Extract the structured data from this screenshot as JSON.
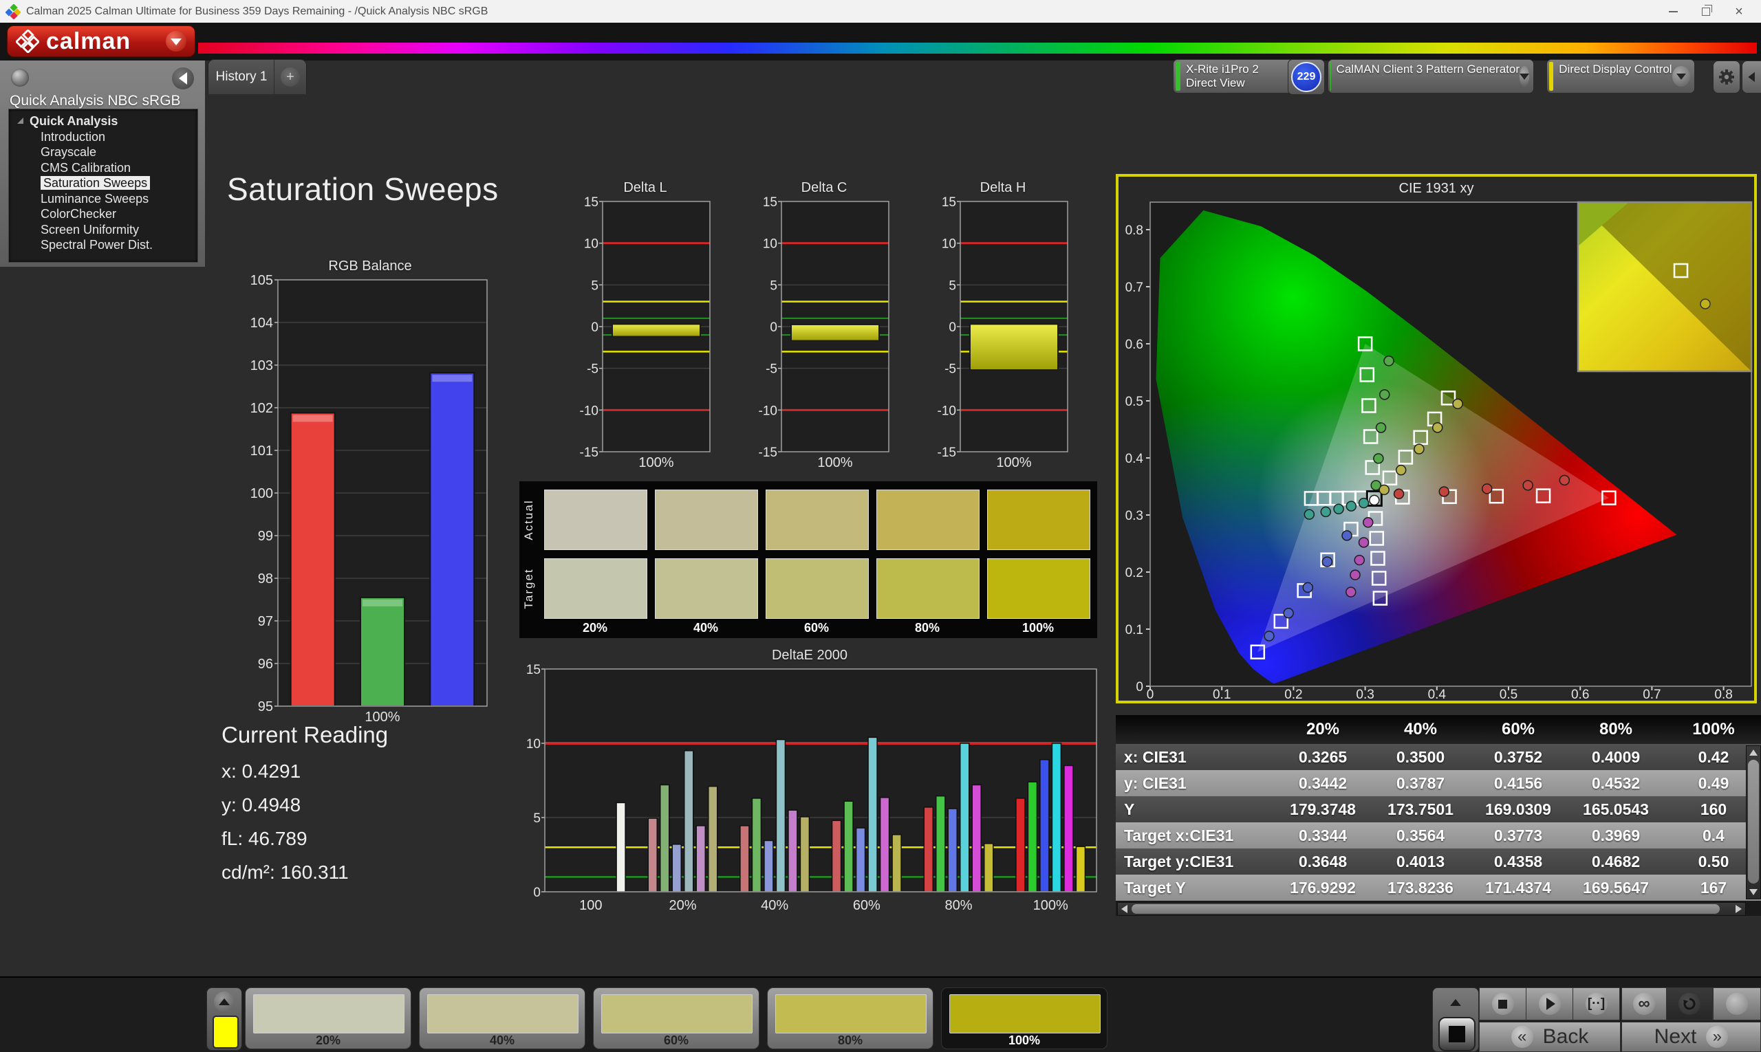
{
  "window": {
    "title": "Calman 2025 Calman Ultimate for Business 359 Days Remaining  - /Quick Analysis NBC sRGB"
  },
  "brand": {
    "logo_text": "calman"
  },
  "sidebar": {
    "title": "Quick Analysis NBC sRGB",
    "root": "Quick Analysis",
    "items": [
      "Introduction",
      "Grayscale",
      "CMS Calibration",
      "Saturation Sweeps",
      "Luminance Sweeps",
      "ColorChecker",
      "Screen Uniformity",
      "Spectral Power Dist."
    ],
    "selected_index": 3
  },
  "tabs": {
    "history": "History 1",
    "add": "+"
  },
  "toolbar": {
    "meter": {
      "line1": "X-Rite i1Pro 2",
      "line2": "Direct View",
      "badge": "229",
      "stripe_color": "#35c02c"
    },
    "pattern_generator": {
      "label": "CalMAN Client 3 Pattern Generator",
      "stripe_color": "#35c02c"
    },
    "display_control": {
      "label": "Direct Display Control",
      "stripe_color": "#e2d400"
    }
  },
  "page": {
    "title": "Saturation Sweeps"
  },
  "current_reading": {
    "title": "Current Reading",
    "rows": [
      {
        "label": "x:",
        "value": "0.4291"
      },
      {
        "label": "y:",
        "value": "0.4948"
      },
      {
        "label": "fL:",
        "value": "46.789"
      },
      {
        "label": "cd/m²:",
        "value": "160.311"
      }
    ]
  },
  "swatch_panel": {
    "row_labels": [
      "Actual",
      "Target"
    ],
    "categories": [
      "20%",
      "40%",
      "60%",
      "80%",
      "100%"
    ],
    "actual_colors": [
      "#c7c4b3",
      "#c4bd99",
      "#c2b97b",
      "#c3b356",
      "#bcab15"
    ],
    "target_colors": [
      "#c4c6ae",
      "#c2c193",
      "#c0bd75",
      "#bdbb4b",
      "#bcb60e"
    ]
  },
  "chart_data": [
    {
      "id": "rgb_balance",
      "type": "bar",
      "title": "RGB Balance",
      "categories": [
        "Red",
        "Green",
        "Blue"
      ],
      "values": [
        101.88,
        97.55,
        102.82
      ],
      "colors": [
        "#e8413c",
        "#4cb050",
        "#4343ee"
      ],
      "xlabel": "100%",
      "ylim": [
        95,
        105
      ],
      "ytick_step": 1
    },
    {
      "id": "delta_l",
      "type": "bar",
      "title": "Delta L",
      "bar": {
        "from": -1.2,
        "to": 0.3
      },
      "ylim": [
        -15,
        15
      ],
      "yticks": [
        -15,
        -10,
        -5,
        0,
        5,
        10,
        15
      ],
      "xlabel": "100%",
      "limit_lines": {
        "red": [
          10,
          -10
        ],
        "yellow": [
          3,
          -3
        ],
        "green": [
          1,
          -1
        ]
      },
      "limit_colors": {
        "red": "#cf2828",
        "yellow": "#e6e600",
        "green": "#1e961e"
      }
    },
    {
      "id": "delta_c",
      "type": "bar",
      "title": "Delta C",
      "bar": {
        "from": -1.7,
        "to": 0.25
      },
      "ylim": [
        -15,
        15
      ],
      "yticks": [
        -15,
        -10,
        -5,
        0,
        5,
        10,
        15
      ],
      "xlabel": "100%",
      "limit_lines": {
        "red": [
          10,
          -10
        ],
        "yellow": [
          3,
          -3
        ],
        "green": [
          1,
          -1
        ]
      },
      "limit_colors": {
        "red": "#cf2828",
        "yellow": "#e6e600",
        "green": "#1e961e"
      }
    },
    {
      "id": "delta_h",
      "type": "bar",
      "title": "Delta H",
      "bar": {
        "from": -5.2,
        "to": 0.3
      },
      "ylim": [
        -15,
        15
      ],
      "yticks": [
        -15,
        -10,
        -5,
        0,
        5,
        10,
        15
      ],
      "xlabel": "100%",
      "limit_lines": {
        "red": [
          10,
          -10
        ],
        "yellow": [
          3,
          -3
        ],
        "green": [
          1,
          -1
        ]
      },
      "limit_colors": {
        "red": "#cf2828",
        "yellow": "#e6e600",
        "green": "#1e961e"
      }
    },
    {
      "id": "deltae2000",
      "type": "bar",
      "title": "DeltaE 2000",
      "categories": [
        "100",
        "20%",
        "40%",
        "60%",
        "80%",
        "100%"
      ],
      "ylim": [
        0,
        15
      ],
      "yticks": [
        0,
        5,
        10,
        15
      ],
      "limit_lines": {
        "red": 10,
        "yellow": 3,
        "green": 1
      },
      "limit_colors": {
        "red": "#cf2828",
        "yellow": "#e6e600",
        "green": "#1e961e"
      },
      "groups": [
        {
          "label": "100",
          "values": [
            6.0
          ],
          "colors": [
            "#f1f1ee"
          ]
        },
        {
          "label": "20%",
          "values": [
            4.95,
            7.2,
            3.2,
            9.5,
            4.45,
            7.1
          ],
          "colors": [
            "#c4878b",
            "#83b173",
            "#96a0d0",
            "#9db8bd",
            "#c08fc6",
            "#b2ae76"
          ]
        },
        {
          "label": "40%",
          "values": [
            4.45,
            6.3,
            3.45,
            10.25,
            5.5,
            5.05
          ],
          "colors": [
            "#c87476",
            "#6fb663",
            "#8a97d8",
            "#8fc2c8",
            "#c57ecb",
            "#b5b065"
          ]
        },
        {
          "label": "60%",
          "values": [
            4.8,
            6.1,
            4.3,
            10.4,
            6.35,
            3.85
          ],
          "colors": [
            "#cd5c5e",
            "#5cbd55",
            "#7a8ce0",
            "#79cad2",
            "#cc68d0",
            "#b9b350"
          ]
        },
        {
          "label": "80%",
          "values": [
            5.7,
            6.45,
            5.6,
            10.0,
            7.2,
            3.25
          ],
          "colors": [
            "#d44244",
            "#44c445",
            "#6277e6",
            "#59d2db",
            "#d34dd7",
            "#c5bd38"
          ]
        },
        {
          "label": "100%",
          "values": [
            6.3,
            7.4,
            8.9,
            10.0,
            8.5,
            3.05
          ],
          "colors": [
            "#dc2627",
            "#2bcc2b",
            "#3b51ee",
            "#2cd7e4",
            "#dc2cdc",
            "#d7cb1d"
          ]
        }
      ]
    },
    {
      "id": "cie1931",
      "type": "scatter",
      "title": "CIE 1931 xy",
      "xlim": [
        0,
        0.8
      ],
      "ylim": [
        0,
        0.85
      ],
      "x_ticks": [
        0,
        0.1,
        0.2,
        0.3,
        0.4,
        0.5,
        0.6,
        0.7,
        0.8
      ],
      "y_ticks": [
        0,
        0.1,
        0.2,
        0.3,
        0.4,
        0.5,
        0.6,
        0.7,
        0.8
      ],
      "white_point": [
        0.3127,
        0.329
      ],
      "gamut_triangle": {
        "red": [
          0.64,
          0.33
        ],
        "green": [
          0.3,
          0.6
        ],
        "blue": [
          0.15,
          0.06
        ]
      },
      "sweep_colors": {
        "red": "#c2443c",
        "green": "#55a84b",
        "blue": "#4f63c9",
        "cyan": "#3da08e",
        "magenta": "#b351b3",
        "yellow": "#b9b24a",
        "white": "#ffffff"
      },
      "targets": {
        "red": [
          [
            0.352,
            0.3313
          ],
          [
            0.4175,
            0.3322
          ],
          [
            0.483,
            0.3329
          ],
          [
            0.5485,
            0.3336
          ],
          [
            0.64,
            0.33
          ]
        ],
        "green": [
          [
            0.3102,
            0.3832
          ],
          [
            0.3077,
            0.4374
          ],
          [
            0.3051,
            0.4916
          ],
          [
            0.3026,
            0.5458
          ],
          [
            0.3,
            0.6
          ]
        ],
        "blue": [
          [
            0.2802,
            0.2752
          ],
          [
            0.2477,
            0.2214
          ],
          [
            0.2151,
            0.1676
          ],
          [
            0.1826,
            0.1138
          ],
          [
            0.15,
            0.06
          ]
        ],
        "cyan": [
          [
            0.2952,
            0.3296
          ],
          [
            0.2776,
            0.3295
          ],
          [
            0.2601,
            0.3293
          ],
          [
            0.2425,
            0.3292
          ],
          [
            0.225,
            0.329
          ]
        ],
        "magenta": [
          [
            0.3143,
            0.294
          ],
          [
            0.316,
            0.2591
          ],
          [
            0.3176,
            0.2241
          ],
          [
            0.3193,
            0.1892
          ],
          [
            0.3209,
            0.1542
          ]
        ],
        "yellow": [
          [
            0.3344,
            0.3648
          ],
          [
            0.3564,
            0.4013
          ],
          [
            0.3773,
            0.4358
          ],
          [
            0.3969,
            0.4682
          ],
          [
            0.416,
            0.505
          ]
        ]
      },
      "measured": {
        "red": [
          [
            0.347,
            0.337
          ],
          [
            0.41,
            0.341
          ],
          [
            0.47,
            0.346
          ],
          [
            0.527,
            0.352
          ],
          [
            0.578,
            0.361
          ]
        ],
        "green": [
          [
            0.315,
            0.352
          ],
          [
            0.3185,
            0.399
          ],
          [
            0.322,
            0.453
          ],
          [
            0.327,
            0.511
          ],
          [
            0.333,
            0.57
          ]
        ],
        "blue": [
          [
            0.2745,
            0.264
          ],
          [
            0.247,
            0.218
          ],
          [
            0.22,
            0.173
          ],
          [
            0.193,
            0.128
          ],
          [
            0.166,
            0.088
          ]
        ],
        "cyan": [
          [
            0.298,
            0.321
          ],
          [
            0.2805,
            0.3155
          ],
          [
            0.263,
            0.3105
          ],
          [
            0.245,
            0.3055
          ],
          [
            0.222,
            0.301
          ]
        ],
        "magenta": [
          [
            0.304,
            0.287
          ],
          [
            0.298,
            0.252
          ],
          [
            0.292,
            0.221
          ],
          [
            0.286,
            0.195
          ],
          [
            0.28,
            0.165
          ]
        ],
        "yellow": [
          [
            0.3265,
            0.3442
          ],
          [
            0.35,
            0.3787
          ],
          [
            0.3752,
            0.4156
          ],
          [
            0.4009,
            0.4532
          ],
          [
            0.4291,
            0.4948
          ]
        ],
        "white": [
          [
            0.3127,
            0.326
          ]
        ]
      }
    },
    {
      "id": "results_table",
      "type": "table",
      "columns": [
        "20%",
        "40%",
        "60%",
        "80%",
        "100%"
      ],
      "rows": [
        {
          "label": "x: CIE31",
          "values": [
            "0.3265",
            "0.3500",
            "0.3752",
            "0.4009",
            "0.42"
          ]
        },
        {
          "label": "y: CIE31",
          "values": [
            "0.3442",
            "0.3787",
            "0.4156",
            "0.4532",
            "0.49"
          ]
        },
        {
          "label": "Y",
          "values": [
            "179.3748",
            "173.7501",
            "169.0309",
            "165.0543",
            "160"
          ]
        },
        {
          "label": "Target x:CIE31",
          "values": [
            "0.3344",
            "0.3564",
            "0.3773",
            "0.3969",
            "0.4"
          ]
        },
        {
          "label": "Target y:CIE31",
          "values": [
            "0.3648",
            "0.4013",
            "0.4358",
            "0.4682",
            "0.50"
          ]
        },
        {
          "label": "Target Y",
          "values": [
            "176.9292",
            "173.8236",
            "171.4374",
            "169.5647",
            "167"
          ]
        }
      ]
    }
  ],
  "bottom_bar": {
    "mini_swatch_color": "#ffff00",
    "swatches": [
      {
        "label": "20%",
        "color": "#c9cab4",
        "selected": false
      },
      {
        "label": "40%",
        "color": "#c6c39a",
        "selected": false
      },
      {
        "label": "60%",
        "color": "#c3c07d",
        "selected": false
      },
      {
        "label": "80%",
        "color": "#c1bb52",
        "selected": false
      },
      {
        "label": "100%",
        "color": "#b7af12",
        "selected": true
      }
    ],
    "back_label": "Back",
    "next_label": "Next",
    "step_icon": "[··]",
    "infinity_icon": "∞"
  }
}
